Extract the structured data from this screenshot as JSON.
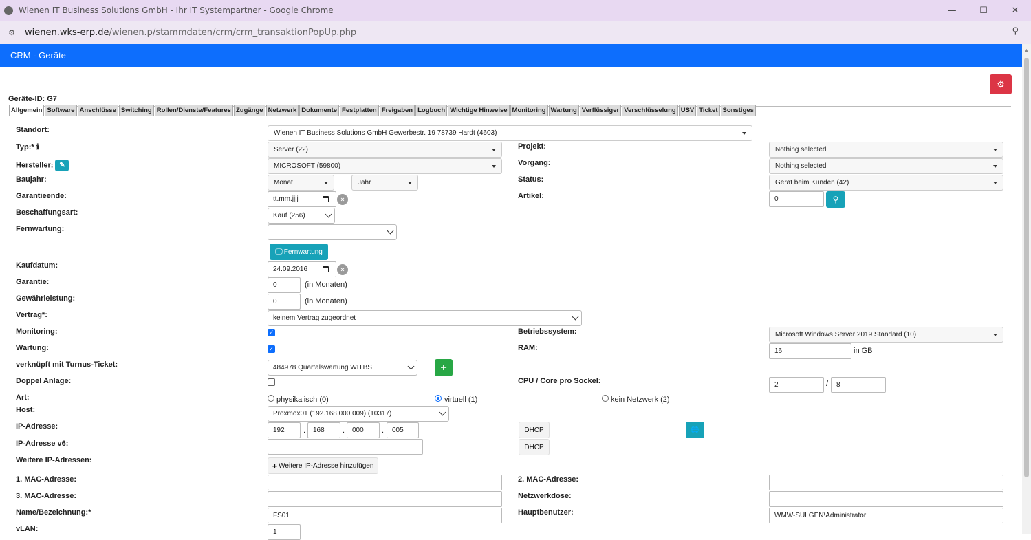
{
  "browser": {
    "title": "Wienen IT Business Solutions GmbH - Ihr IT Systempartner - Google Chrome",
    "url_host": "wienen.wks-erp.de",
    "url_path": "/wienen.p/stammdaten/crm/crm_transaktionPopUp.php",
    "minimize": "—",
    "maximize": "☐",
    "close": "✕",
    "zoom_icon": "search-icon"
  },
  "header": {
    "title": "CRM - Geräte",
    "gear_icon": "⚙"
  },
  "device_id": "Geräte-ID: G7",
  "tabs": [
    "Allgemein",
    "Software",
    "Anschlüsse",
    "Switching",
    "Rollen/Dienste/Features",
    "Zugänge",
    "Netzwerk",
    "Dokumente",
    "Festplatten",
    "Freigaben",
    "Logbuch",
    "Wichtige Hinweise",
    "Monitoring",
    "Wartung",
    "Verflüssiger",
    "Verschlüsselung",
    "USV",
    "Ticket",
    "Sonstiges"
  ],
  "form": {
    "standort": {
      "label": "Standort:",
      "value": "Wienen IT Business Solutions GmbH Gewerbestr. 19 78739 Hardt (4603)"
    },
    "typ": {
      "label": "Typ:*",
      "info": "ℹ",
      "value": "Server (22)"
    },
    "hersteller": {
      "label": "Hersteller:",
      "edit": "✎",
      "value": "MICROSOFT (59800)"
    },
    "baujahr": {
      "label": "Baujahr:",
      "monat": "Monat",
      "jahr": "Jahr"
    },
    "garantieende": {
      "label": "Garantieende:",
      "placeholder": "tt.mm.jjjj",
      "clear": "×"
    },
    "beschaffungsart": {
      "label": "Beschaffungsart:",
      "value": "Kauf (256)"
    },
    "fernwartung": {
      "label": "Fernwartung:",
      "value": "",
      "button": "Fernwartung"
    },
    "kaufdatum": {
      "label": "Kaufdatum:",
      "value": "24.09.2016",
      "clear": "×"
    },
    "garantie": {
      "label": "Garantie:",
      "value": "0",
      "unit": "(in Monaten)"
    },
    "gewaehrleistung": {
      "label": "Gewährleistung:",
      "value": "0",
      "unit": "(in Monaten)"
    },
    "vertrag": {
      "label": "Vertrag*:",
      "value": "keinem Vertrag zugeordnet"
    },
    "monitoring": {
      "label": "Monitoring:",
      "checked": true
    },
    "wartung": {
      "label": "Wartung:",
      "checked": true
    },
    "turnus": {
      "label": "verknüpft mit Turnus-Ticket:",
      "value": "484978 Quartalswartung WITBS",
      "add": "+"
    },
    "doppel": {
      "label": "Doppel Anlage:",
      "checked": false
    },
    "art": {
      "label": "Art:",
      "opt1": "physikalisch (0)",
      "opt2": "virtuell (1)",
      "opt3": "kein Netzwerk (2)",
      "selected": "virtuell (1)"
    },
    "host": {
      "label": "Host:",
      "value": "Proxmox01 (192.168.000.009) (10317)"
    },
    "ip": {
      "label": "IP-Adresse:",
      "o1": "192",
      "o2": "168",
      "o3": "000",
      "o4": "005",
      "dot": ".",
      "dhcp": "DHCP",
      "globe": "🌐"
    },
    "ipv6": {
      "label": "IP-Adresse v6:",
      "value": "",
      "dhcp": "DHCP"
    },
    "weitere_ip": {
      "label": "Weitere IP-Adressen:",
      "button": "Weitere IP-Adresse hinzufügen",
      "plus": "+"
    },
    "mac1": {
      "label": "1. MAC-Adresse:",
      "value": ""
    },
    "mac3": {
      "label": "3. MAC-Adresse:",
      "value": ""
    },
    "name": {
      "label": "Name/Bezeichnung:*",
      "value": "FS01"
    },
    "vlan": {
      "label": "vLAN:",
      "value": "1"
    },
    "projekt": {
      "label": "Projekt:",
      "value": "Nothing selected"
    },
    "vorgang": {
      "label": "Vorgang:",
      "value": "Nothing selected"
    },
    "status": {
      "label": "Status:",
      "value": "Gerät beim Kunden (42)"
    },
    "artikel": {
      "label": "Artikel:",
      "value": "0"
    },
    "betriebssystem": {
      "label": "Betriebssystem:",
      "value": "Microsoft Windows Server 2019 Standard (10)"
    },
    "ram": {
      "label": "RAM:",
      "value": "16",
      "unit": "in GB"
    },
    "cpu": {
      "label": "CPU / Core pro Sockel:",
      "cpu": "2",
      "sep": "/",
      "core": "8"
    },
    "mac2": {
      "label": "2. MAC-Adresse:",
      "value": ""
    },
    "netzwerkdose": {
      "label": "Netzwerkdose:",
      "value": ""
    },
    "hauptbenutzer": {
      "label": "Hauptbenutzer:",
      "value": "WMW-SULGEN\\Administrator"
    }
  }
}
